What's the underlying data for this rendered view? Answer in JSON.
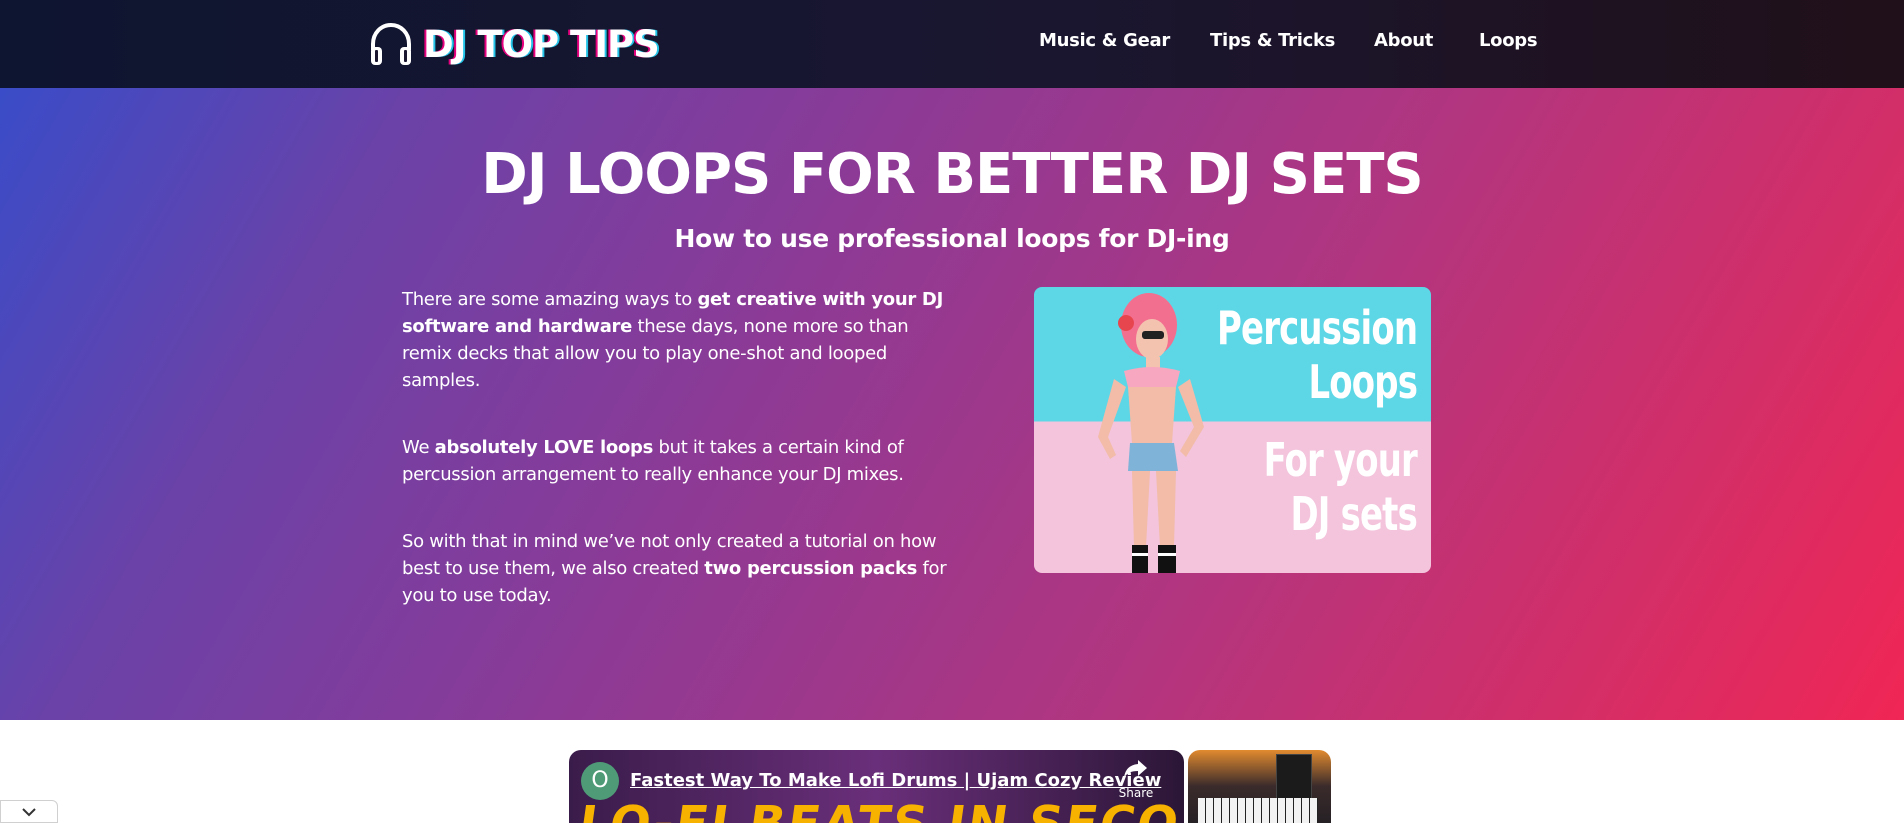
{
  "header": {
    "logo_text": "DJ TOP TIPS",
    "logo_icon": "headphones-icon",
    "nav": [
      {
        "label": "Music & Gear"
      },
      {
        "label": "Tips & Tricks"
      },
      {
        "label": "About"
      },
      {
        "label": "Loops"
      }
    ]
  },
  "hero": {
    "title": "DJ LOOPS FOR BETTER DJ SETS",
    "subtitle": "How to use professional loops for DJ-ing",
    "paragraphs": [
      {
        "pre": "There are some amazing ways to ",
        "bold": "get creative with your DJ software and hardware",
        "post": " these days, none more so than remix decks that allow you to play one-shot and looped samples."
      },
      {
        "pre": "We ",
        "bold": "absolutely LOVE loops",
        "post": " but it takes a certain kind of percussion arrangement to really enhance your DJ mixes."
      },
      {
        "pre": "So with that in mind we’ve not only created a tutorial on how best to use them, we also created ",
        "bold": "two percussion packs",
        "post": " for you to use today."
      }
    ],
    "image": {
      "line1": "Percussion",
      "line2": "Loops",
      "line3": "For your",
      "line4": "DJ sets"
    }
  },
  "video": {
    "channel_initial": "O",
    "title": "Fastest Way To Make Lofi Drums | Ujam Cozy Review",
    "share_label": "Share",
    "thumbnail_text": "LO-FI BEATS IN SECONDS"
  },
  "colors": {
    "header_bg": "#141428",
    "hero_gradient_start": "#3a4cc8",
    "hero_gradient_end": "#f02655",
    "accent_pink": "#e6007e",
    "accent_cyan": "#23c4e8"
  }
}
